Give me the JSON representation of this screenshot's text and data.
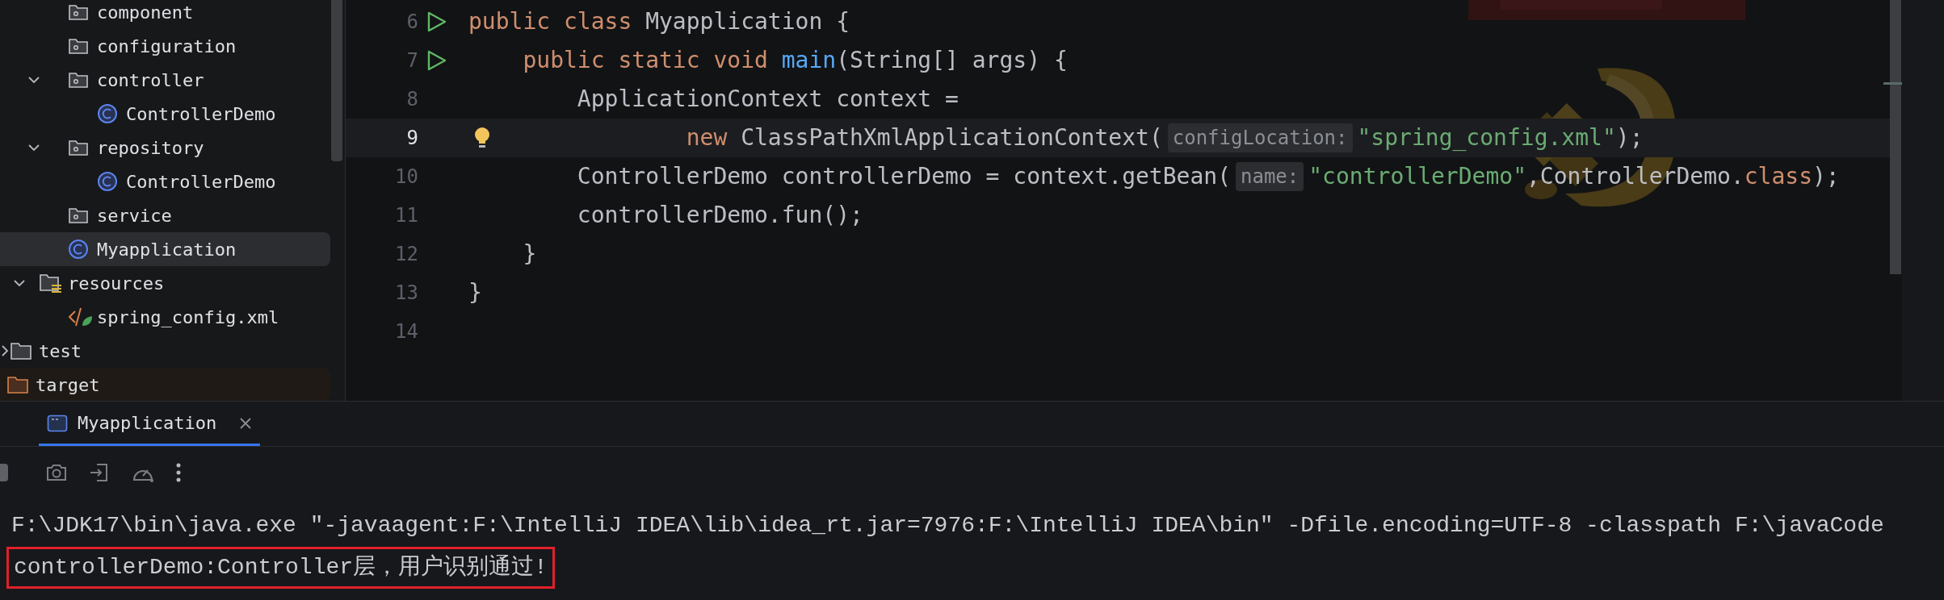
{
  "project_tree": {
    "items": [
      {
        "children": [
          {
            "children": [
              {
                "children": [
                  {
                    "label": "component",
                    "kind": "package",
                    "selected": false
                  },
                  {
                    "label": "configuration",
                    "kind": "package",
                    "selected": false
                  },
                  {
                    "label": "controller",
                    "kind": "package",
                    "selected": false,
                    "expanded": true,
                    "children": [
                      {
                        "label": "ControllerDemo",
                        "kind": "class",
                        "selected": false
                      }
                    ]
                  },
                  {
                    "label": "repository",
                    "kind": "package",
                    "selected": false,
                    "expanded": true,
                    "children": [
                      {
                        "label": "ControllerDemo",
                        "kind": "class",
                        "selected": false
                      }
                    ]
                  },
                  {
                    "label": "service",
                    "kind": "package",
                    "selected": false
                  },
                  {
                    "label": "Myapplication",
                    "kind": "class",
                    "selected": true
                  }
                ]
              },
              {
                "label": "resources",
                "kind": "resources",
                "selected": false,
                "expanded": true,
                "children": [
                  {
                    "label": "spring_config.xml",
                    "kind": "xml",
                    "selected": false
                  }
                ]
              }
            ]
          },
          {
            "label": "test",
            "kind": "folder",
            "selected": false,
            "expanded": false
          }
        ]
      },
      {
        "label": "target",
        "kind": "excluded",
        "selected": false
      }
    ]
  },
  "editor": {
    "lines": [
      {
        "number": "6",
        "run": true,
        "current": false,
        "bulb": false,
        "tokens": [
          {
            "kind": "keyword",
            "text": "public class "
          },
          {
            "kind": "plain",
            "text": "Myapplication {"
          }
        ]
      },
      {
        "number": "7",
        "run": true,
        "current": false,
        "bulb": false,
        "tokens": [
          {
            "kind": "keyword",
            "text": "    public static void "
          },
          {
            "kind": "method",
            "text": "main"
          },
          {
            "kind": "plain",
            "text": "(String[] args) {"
          }
        ]
      },
      {
        "number": "8",
        "run": false,
        "current": false,
        "bulb": false,
        "tokens": [
          {
            "kind": "plain",
            "text": "        ApplicationContext context ="
          }
        ]
      },
      {
        "number": "9",
        "run": false,
        "current": true,
        "bulb": true,
        "tokens": [
          {
            "kind": "keyword",
            "text": "                new "
          },
          {
            "kind": "plain",
            "text": "ClassPathXmlApplicationContext("
          },
          {
            "kind": "hint",
            "text": "configLocation:"
          },
          {
            "kind": "string",
            "text": "\"spring_config.xml\""
          },
          {
            "kind": "plain",
            "text": ");"
          }
        ]
      },
      {
        "number": "10",
        "run": false,
        "current": false,
        "bulb": false,
        "tokens": [
          {
            "kind": "plain",
            "text": "        ControllerDemo controllerDemo = context.getBean("
          },
          {
            "kind": "hint",
            "text": "name:"
          },
          {
            "kind": "string",
            "text": "\"controllerDemo\""
          },
          {
            "kind": "plain",
            "text": ",ControllerDemo."
          },
          {
            "kind": "keyword",
            "text": "class"
          },
          {
            "kind": "plain",
            "text": ");"
          }
        ]
      },
      {
        "number": "11",
        "run": false,
        "current": false,
        "bulb": false,
        "tokens": [
          {
            "kind": "plain",
            "text": "        controllerDemo.fun();"
          }
        ]
      },
      {
        "number": "12",
        "run": false,
        "current": false,
        "bulb": false,
        "tokens": [
          {
            "kind": "plain",
            "text": "    }"
          }
        ]
      },
      {
        "number": "13",
        "run": false,
        "current": false,
        "bulb": false,
        "tokens": [
          {
            "kind": "plain",
            "text": "}"
          }
        ]
      },
      {
        "number": "14",
        "run": false,
        "current": false,
        "bulb": false
      }
    ]
  },
  "run_panel": {
    "tabs": [
      {
        "label": "Myapplication",
        "selected": true
      }
    ],
    "console": [
      {
        "text": "F:\\JDK17\\bin\\java.exe \"-javaagent:F:\\IntelliJ IDEA\\lib\\idea_rt.jar=7976:F:\\IntelliJ IDEA\\bin\" -Dfile.encoding=UTF-8 -classpath F:\\javaCode",
        "boxed": false
      },
      {
        "text": "controllerDemo:Controller层，用户识别通过!",
        "boxed": true
      }
    ]
  }
}
